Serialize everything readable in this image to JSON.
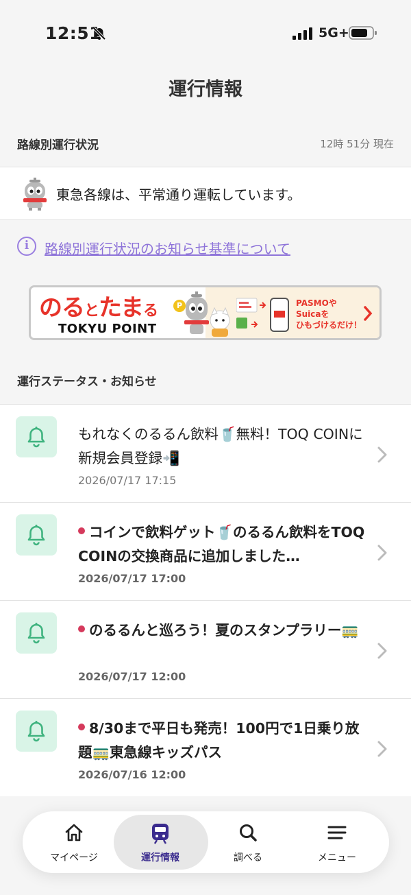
{
  "status_bar": {
    "time": "12:51",
    "network": "5G+"
  },
  "header": {
    "title": "運行情報"
  },
  "route_status": {
    "label": "路線別運行状況",
    "updated": "12時 51分 現在",
    "message": "東急各線は、平常通り運転しています。"
  },
  "info_link": {
    "text": "路線別運行状況のお知らせ基準について"
  },
  "banner": {
    "brand_a": "のる",
    "brand_b": "と",
    "brand_c": "たま",
    "brand_d": "る",
    "sub": "TOKYU POINT",
    "coin": "P",
    "cta_line1": "PASMOや",
    "cta_line2": "Suicaを",
    "cta_line3": "ひもづけるだけ！"
  },
  "notices": {
    "label": "運行ステータス・お知らせ",
    "items": [
      {
        "title": "もれなくのるるん飲料🥤無料！TOQ COINに新規会員登録📲",
        "date": "2026/07/17 17:15",
        "unread": false
      },
      {
        "title": "コインで飲料ゲット🥤のるるん飲料をTOQ COINの交換商品に追加しました…",
        "date": "2026/07/17 17:00",
        "unread": true
      },
      {
        "title": "のるるんと巡ろう！夏のスタンプラリー🚃",
        "date": "2026/07/17 12:00",
        "unread": true
      },
      {
        "title": "8/30まで平日も発売！100円で1日乗り放題🚃東急線キッズパス",
        "date": "2026/07/16 12:00",
        "unread": true
      }
    ]
  },
  "tabbar": {
    "tabs": [
      {
        "label": "マイページ",
        "icon": "home-icon"
      },
      {
        "label": "運行情報",
        "icon": "train-icon"
      },
      {
        "label": "調べる",
        "icon": "search-icon"
      },
      {
        "label": "メニュー",
        "icon": "menu-icon"
      }
    ],
    "active": "運行情報"
  },
  "colors": {
    "accent": "#3b2c8e",
    "link": "#8e74d9",
    "unread_dot": "#d53a5c",
    "icon_bg": "#d9f4e7",
    "bell": "#3fb37f"
  }
}
